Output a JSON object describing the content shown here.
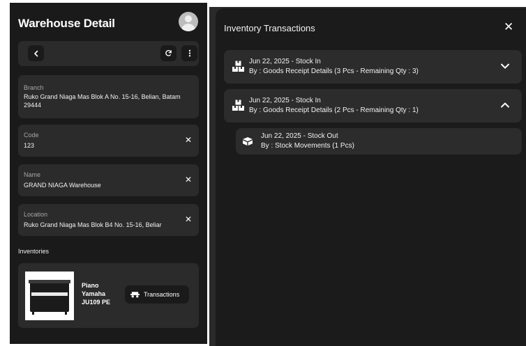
{
  "left_panel": {
    "title": "Warehouse Detail",
    "fields": {
      "branch": {
        "label": "Branch",
        "value": "Ruko Grand Niaga Mas Blok A No. 15-16, Belian, Batam 29444"
      },
      "code": {
        "label": "Code",
        "value": "123"
      },
      "name": {
        "label": "Name",
        "value": "GRAND NIAGA Warehouse"
      },
      "location": {
        "label": "Location",
        "value": "Ruko Grand Niaga Mas Blok B4 No. 15-16, Beliar"
      }
    },
    "inventories_label": "Inventories",
    "product": {
      "name": "Piano Yamaha JU109 PE"
    },
    "transactions_button": "Transactions"
  },
  "dialog": {
    "title": "Inventory Transactions",
    "transactions": [
      {
        "title": "Jun 22, 2025 - Stock In",
        "detail": "By : Goods Receipt Details (3 Pcs - Remaining Qty : 3)",
        "expanded": false
      },
      {
        "title": "Jun 22, 2025 - Stock In",
        "detail": "By : Goods Receipt Details (2 Pcs - Remaining Qty : 1)",
        "expanded": true,
        "children": [
          {
            "title": "Jun 22, 2025 - Stock Out",
            "detail": "By : Stock Movements (1 Pcs)"
          }
        ]
      }
    ]
  },
  "colors": {
    "panel": "#1a1a1a",
    "card": "#2b2b2b",
    "text": "#f2f2f2",
    "muted": "#a7a7a7"
  },
  "icons": [
    "back-icon",
    "refresh-icon",
    "more-icon",
    "clear-icon",
    "transactions-icon",
    "stock-in-icon",
    "stock-out-icon",
    "chevron-down-icon",
    "chevron-up-icon",
    "close-icon"
  ]
}
